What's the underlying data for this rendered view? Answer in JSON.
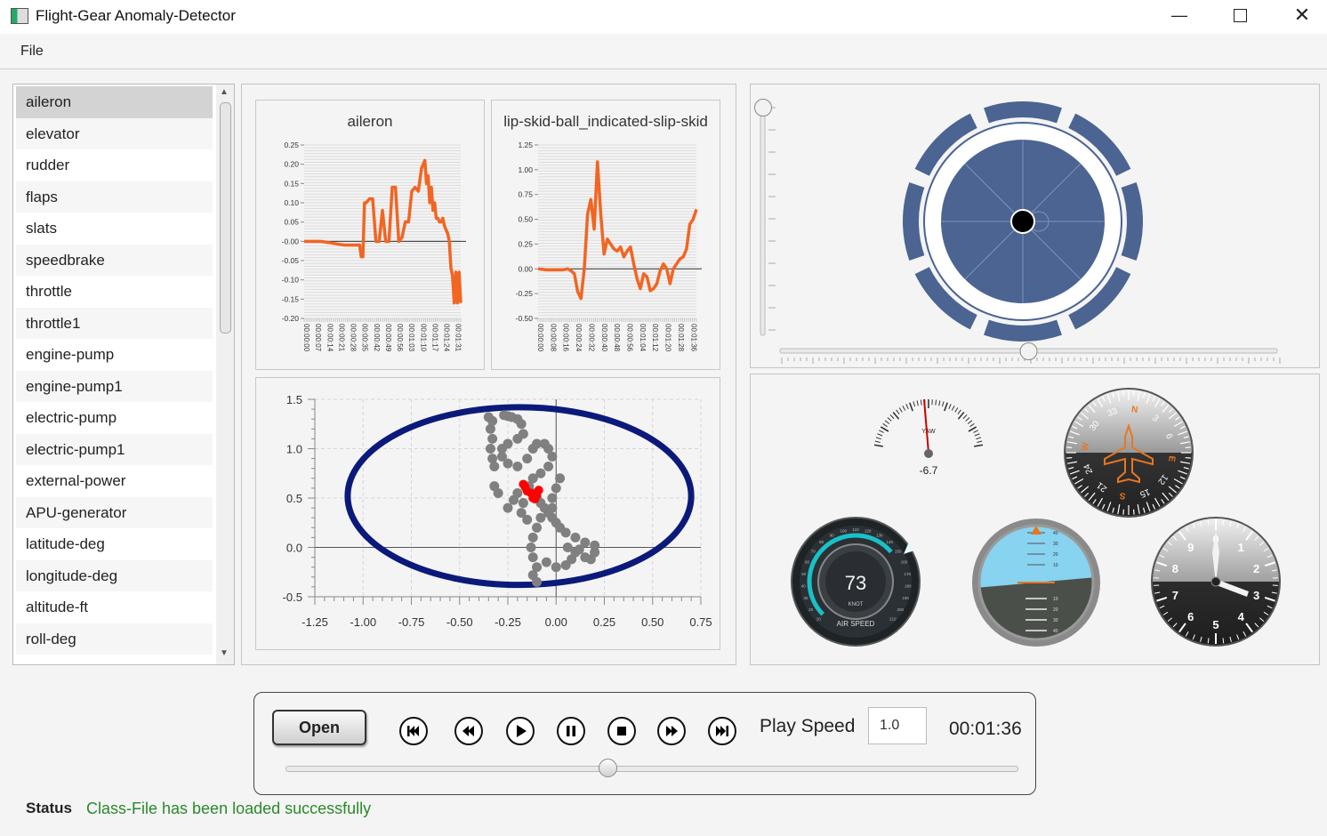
{
  "window": {
    "title": "Flight-Gear Anomaly-Detector"
  },
  "menu": {
    "file": "File"
  },
  "attributes": [
    "aileron",
    "elevator",
    "rudder",
    "flaps",
    "slats",
    "speedbrake",
    "throttle",
    "throttle1",
    "engine-pump",
    "engine-pump1",
    "electric-pump",
    "electric-pump1",
    "external-power",
    "APU-generator",
    "latitude-deg",
    "longitude-deg",
    "altitude-ft",
    "roll-deg"
  ],
  "selected_attribute": "aileron",
  "chart_data": [
    {
      "type": "line",
      "title": "aileron",
      "ylim": [
        -0.2,
        0.25
      ],
      "yticks": [
        "0.25",
        "0.20",
        "0.15",
        "0.10",
        "0.05",
        "-0.00",
        "-0.05",
        "-0.10",
        "-0.15",
        "-0.20"
      ],
      "xticks": [
        "00:00:00",
        "00:00:07",
        "00:00:14",
        "00:00:21",
        "00:00:28",
        "00:00:35",
        "00:00:42",
        "00:00:49",
        "00:00:56",
        "00:01:03",
        "00:01:10",
        "00:01:17",
        "00:01:24",
        "00:01:31"
      ],
      "series_color": "#f26522",
      "x": [
        0,
        10,
        25,
        30,
        34,
        35,
        36,
        37,
        38,
        40,
        42,
        44,
        46,
        48,
        50,
        52,
        54,
        56,
        58,
        60,
        62,
        64,
        66,
        68,
        70,
        72,
        74,
        75,
        76,
        77,
        78,
        79,
        80,
        81,
        82,
        83,
        84,
        85,
        86,
        87,
        88,
        89,
        90,
        91,
        92,
        93,
        94,
        95,
        96
      ],
      "values": [
        0,
        0,
        -0.01,
        -0.01,
        -0.01,
        -0.04,
        -0.04,
        0.1,
        0.1,
        0.11,
        0.11,
        0.0,
        0.0,
        0.08,
        0.0,
        0.0,
        0.14,
        0.14,
        0.0,
        0.01,
        0.05,
        0.05,
        0.13,
        0.14,
        0.13,
        0.19,
        0.21,
        0.15,
        0.17,
        0.1,
        0.14,
        0.08,
        0.1,
        0.06,
        0.06,
        0.05,
        0.05,
        0.06,
        0.04,
        0.03,
        0.02,
        0.0,
        -0.07,
        -0.09,
        -0.16,
        -0.08,
        -0.16,
        -0.08,
        -0.16
      ]
    },
    {
      "type": "line",
      "title": "lip-skid-ball_indicated-slip-skid",
      "ylim": [
        -0.5,
        1.25
      ],
      "yticks": [
        "1.25",
        "1.00",
        "0.75",
        "0.50",
        "0.25",
        "0.00",
        "-0.25",
        "-0.50"
      ],
      "xticks": [
        "00:00:00",
        "00:00:08",
        "00:00:16",
        "00:00:24",
        "00:00:32",
        "00:00:40",
        "00:00:48",
        "00:00:56",
        "00:01:04",
        "00:01:12",
        "00:01:20",
        "00:01:28",
        "00:01:36"
      ],
      "series_color": "#f26522",
      "x": [
        0,
        5,
        10,
        15,
        18,
        20,
        22,
        24,
        26,
        28,
        30,
        32,
        34,
        36,
        38,
        40,
        42,
        44,
        46,
        48,
        50,
        52,
        54,
        56,
        58,
        60,
        62,
        64,
        66,
        68,
        70,
        72,
        74,
        76,
        78,
        80,
        82,
        84,
        86,
        88,
        90,
        92,
        94,
        96
      ],
      "values": [
        0.0,
        -0.01,
        -0.01,
        -0.01,
        0.0,
        -0.02,
        -0.05,
        -0.23,
        -0.3,
        0.0,
        0.55,
        0.7,
        0.4,
        1.08,
        0.55,
        0.15,
        0.3,
        0.25,
        0.2,
        0.18,
        0.22,
        0.12,
        0.18,
        0.22,
        0.05,
        -0.1,
        -0.2,
        -0.05,
        -0.08,
        -0.22,
        -0.2,
        -0.15,
        -0.02,
        0.05,
        0.0,
        -0.15,
        0.0,
        0.05,
        0.1,
        0.12,
        0.2,
        0.45,
        0.5,
        0.6
      ]
    },
    {
      "type": "scatter",
      "xlim": [
        -1.25,
        0.75
      ],
      "ylim": [
        -0.5,
        1.5
      ],
      "xticks": [
        "-1.25",
        "-1.00",
        "-0.75",
        "-0.50",
        "-0.25",
        "0.00",
        "0.25",
        "0.50",
        "0.75"
      ],
      "yticks": [
        "1.5",
        "1.0",
        "0.5",
        "0.0",
        "-0.5"
      ],
      "ellipse": {
        "cx": -0.19,
        "cy": 0.52,
        "rx": 0.89,
        "ry": 0.9,
        "color": "#0b1a7a"
      },
      "normal_color": "#808080",
      "anomaly_color": "#ff0000",
      "normal_points": [
        [
          -0.35,
          1.32
        ],
        [
          -0.33,
          1.28
        ],
        [
          -0.34,
          1.2
        ],
        [
          -0.33,
          1.1
        ],
        [
          -0.34,
          1.0
        ],
        [
          -0.33,
          0.9
        ],
        [
          -0.32,
          0.82
        ],
        [
          -0.27,
          1.34
        ],
        [
          -0.25,
          1.33
        ],
        [
          -0.23,
          1.32
        ],
        [
          -0.2,
          1.3
        ],
        [
          -0.18,
          1.25
        ],
        [
          -0.17,
          1.15
        ],
        [
          -0.2,
          1.1
        ],
        [
          -0.25,
          1.05
        ],
        [
          -0.28,
          1.0
        ],
        [
          -0.28,
          0.92
        ],
        [
          -0.25,
          0.85
        ],
        [
          -0.2,
          0.82
        ],
        [
          -0.15,
          0.9
        ],
        [
          -0.12,
          1.0
        ],
        [
          -0.1,
          1.05
        ],
        [
          -0.06,
          1.05
        ],
        [
          -0.04,
          1.0
        ],
        [
          -0.02,
          0.92
        ],
        [
          -0.04,
          0.82
        ],
        [
          -0.08,
          0.75
        ],
        [
          -0.12,
          0.7
        ],
        [
          -0.14,
          0.62
        ],
        [
          -0.12,
          0.55
        ],
        [
          -0.1,
          0.5
        ],
        [
          -0.08,
          0.45
        ],
        [
          -0.06,
          0.4
        ],
        [
          -0.04,
          0.35
        ],
        [
          -0.02,
          0.3
        ],
        [
          0.0,
          0.25
        ],
        [
          0.02,
          0.2
        ],
        [
          0.05,
          0.15
        ],
        [
          0.1,
          0.1
        ],
        [
          0.15,
          0.05
        ],
        [
          0.2,
          0.02
        ],
        [
          0.2,
          -0.05
        ],
        [
          0.15,
          -0.1
        ],
        [
          0.1,
          -0.05
        ],
        [
          0.08,
          -0.12
        ],
        [
          0.05,
          -0.18
        ],
        [
          0.0,
          -0.2
        ],
        [
          -0.05,
          -0.15
        ],
        [
          -0.1,
          -0.2
        ],
        [
          -0.12,
          -0.28
        ],
        [
          -0.1,
          -0.35
        ],
        [
          -0.12,
          -0.1
        ],
        [
          -0.13,
          0.0
        ],
        [
          -0.12,
          0.1
        ],
        [
          -0.1,
          0.2
        ],
        [
          -0.08,
          0.3
        ],
        [
          -0.02,
          0.5
        ],
        [
          0.0,
          0.6
        ],
        [
          0.02,
          0.7
        ],
        [
          -0.02,
          0.4
        ],
        [
          -0.25,
          0.4
        ],
        [
          -0.22,
          0.48
        ],
        [
          -0.3,
          0.55
        ],
        [
          -0.32,
          0.62
        ],
        [
          -0.18,
          0.35
        ],
        [
          -0.15,
          0.28
        ],
        [
          -0.17,
          0.45
        ],
        [
          -0.2,
          0.55
        ],
        [
          0.06,
          0.0
        ],
        [
          0.12,
          -0.02
        ],
        [
          0.18,
          -0.12
        ]
      ],
      "anomaly_points": [
        [
          -0.16,
          0.61
        ],
        [
          -0.15,
          0.57
        ],
        [
          -0.13,
          0.55
        ],
        [
          -0.1,
          0.53
        ],
        [
          -0.09,
          0.58
        ],
        [
          -0.11,
          0.49
        ],
        [
          -0.17,
          0.64
        ],
        [
          -0.12,
          0.5
        ]
      ]
    }
  ],
  "joystick": {
    "aileron": 0,
    "elevator": 0,
    "rudder_slider": 0.5,
    "throttle_slider": 1.0,
    "colors": {
      "ring": "#4b6491",
      "knob": "#000000"
    }
  },
  "gauges": {
    "yaw": {
      "label": "YAW",
      "value": "-6.7"
    },
    "airspeed": {
      "value": "73",
      "unit": "KNOT",
      "label": "AIR SPEED",
      "scale": [
        "10",
        "20",
        "30",
        "40",
        "50",
        "60",
        "70",
        "80",
        "90",
        "100",
        "110",
        "120",
        "130",
        "140",
        "150",
        "160",
        "170",
        "180",
        "190",
        "200",
        "210"
      ]
    },
    "heading": {
      "labels": [
        "N",
        "3",
        "6",
        "E",
        "12",
        "15",
        "S",
        "21",
        "24",
        "W",
        "30",
        "33"
      ]
    },
    "attitude": {
      "scale_up": [
        "10",
        "20",
        "30",
        "40"
      ],
      "scale_down": [
        "10",
        "20",
        "30",
        "40"
      ]
    },
    "altimeter": {
      "labels": [
        "0",
        "1",
        "2",
        "3",
        "4",
        "5",
        "6",
        "7",
        "8",
        "9"
      ]
    }
  },
  "player": {
    "open_label": "Open",
    "controls": [
      "skip-to-start",
      "rewind",
      "play",
      "pause",
      "stop",
      "fast-forward",
      "skip-to-end"
    ],
    "play_speed_label": "Play Speed",
    "play_speed_value": "1.0",
    "time": "00:01:36",
    "progress": 0.44
  },
  "status": {
    "label": "Status",
    "message": "Class-File has been loaded successfully"
  }
}
